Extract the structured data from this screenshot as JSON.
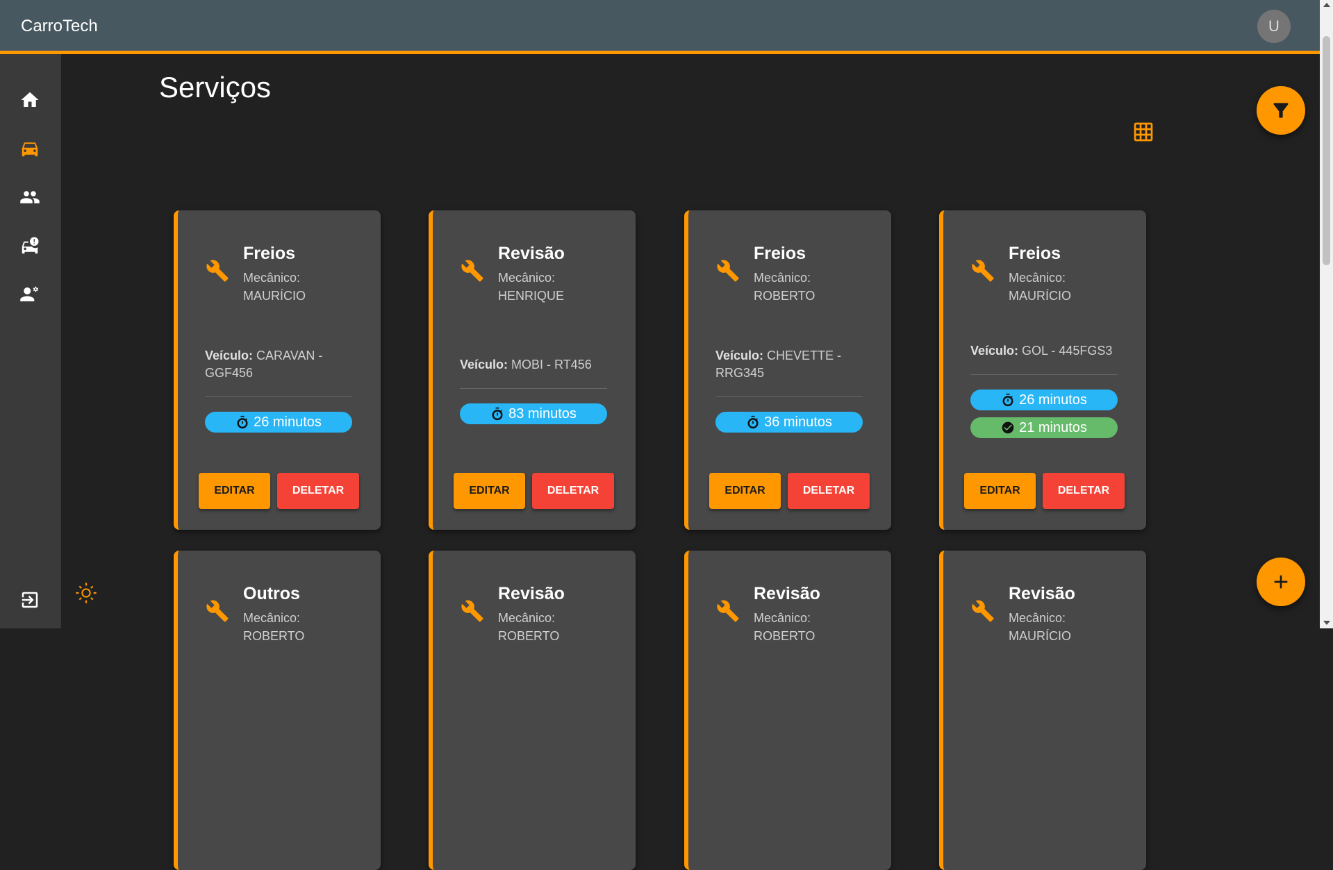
{
  "app": {
    "title": "CarroTech",
    "avatar_letter": "U"
  },
  "nav": {
    "items": [
      {
        "name": "home",
        "icon": "home-icon",
        "active": false
      },
      {
        "name": "services",
        "icon": "car-icon",
        "active": true
      },
      {
        "name": "clients",
        "icon": "people-icon",
        "active": false
      },
      {
        "name": "vehicle-alert",
        "icon": "car-alert-icon",
        "active": false
      },
      {
        "name": "mechanics",
        "icon": "engineer-icon",
        "active": false
      }
    ],
    "logout_icon": "logout-icon",
    "theme_icon": "sun-icon"
  },
  "page": {
    "title": "Serviços",
    "view_icon": "grid-icon"
  },
  "colors": {
    "accent": "#ff9800",
    "estimate": "#29b6f6",
    "actual": "#66bb6a",
    "delete": "#f44336"
  },
  "labels": {
    "mechanic": "Mecânico:",
    "vehicle": "Veículo:",
    "edit": "EDITAR",
    "delete": "DELETAR"
  },
  "services": [
    {
      "title": "Freios",
      "mechanic": "MAURÍCIO",
      "vehicle": "CARAVAN - GGF456",
      "estimate": "26 minutos",
      "actual": ""
    },
    {
      "title": "Revisão",
      "mechanic": "HENRIQUE",
      "vehicle": "MOBI - RT456",
      "estimate": "83 minutos",
      "actual": ""
    },
    {
      "title": "Freios",
      "mechanic": "ROBERTO",
      "vehicle": "CHEVETTE - RRG345",
      "estimate": "36 minutos",
      "actual": ""
    },
    {
      "title": "Freios",
      "mechanic": "MAURÍCIO",
      "vehicle": "GOL - 445FGS3",
      "estimate": "26 minutos",
      "actual": "21 minutos"
    },
    {
      "title": "Outros",
      "mechanic": "ROBERTO"
    },
    {
      "title": "Revisão",
      "mechanic": "ROBERTO"
    },
    {
      "title": "Revisão",
      "mechanic": "ROBERTO"
    },
    {
      "title": "Revisão",
      "mechanic": "MAURÍCIO"
    }
  ]
}
